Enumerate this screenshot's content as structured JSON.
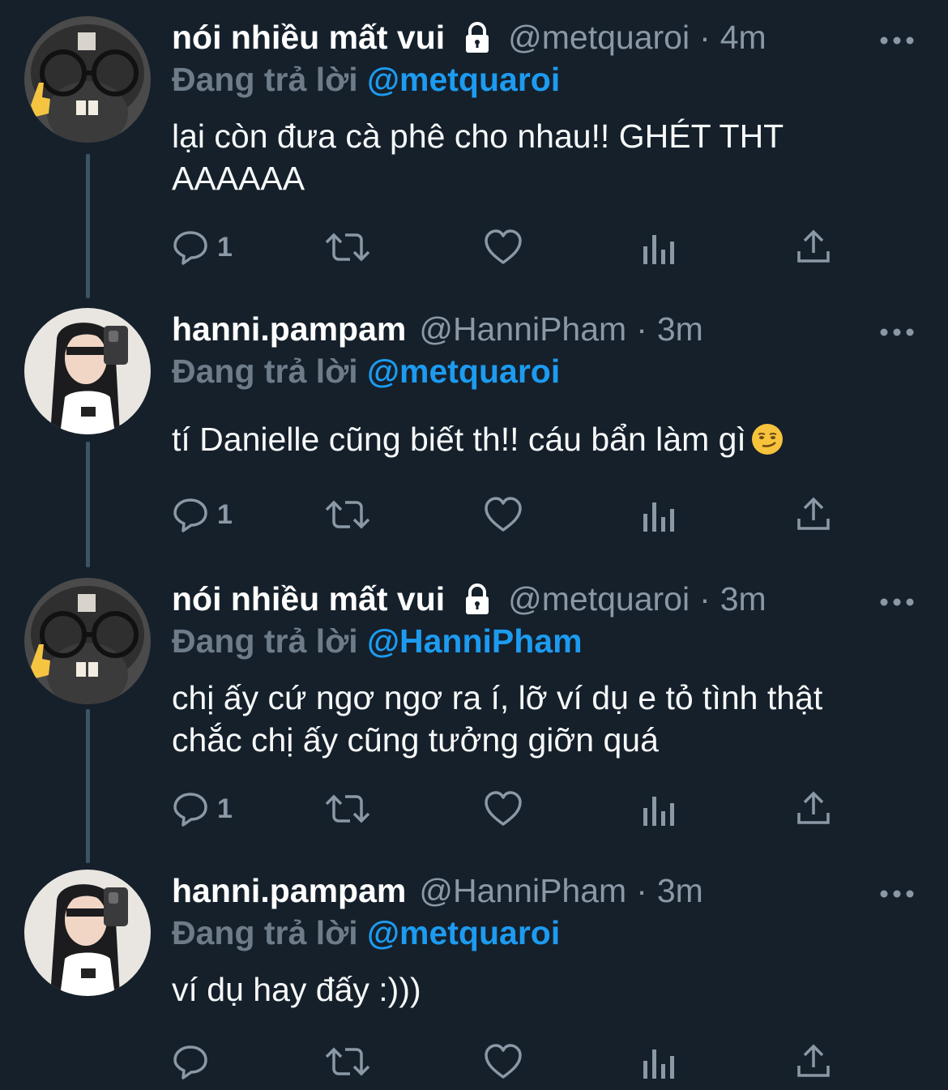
{
  "tweets": [
    {
      "name": "nói nhiều mất vui",
      "locked": true,
      "handle": "@metquaroi",
      "separator": "·",
      "time": "4m",
      "reply_label": "Đang trả lời",
      "reply_to": "@metquaroi",
      "text": "lại còn đưa cà phê cho nhau!! GHÉT THT AAAAAA",
      "reply_count": "1",
      "avatar": "cat-with-glasses"
    },
    {
      "name": "hanni.pampam",
      "locked": false,
      "handle": "@HanniPham",
      "separator": "·",
      "time": "3m",
      "reply_label": "Đang trả lời",
      "reply_to": "@metquaroi",
      "text": "tí Danielle cũng biết th!! cáu bẩn làm gì",
      "emoji": "smirking-face",
      "reply_count": "1",
      "avatar": "girl-mirror-selfie"
    },
    {
      "name": "nói nhiều mất vui",
      "locked": true,
      "handle": "@metquaroi",
      "separator": "·",
      "time": "3m",
      "reply_label": "Đang trả lời",
      "reply_to": "@HanniPham",
      "text": "chị ấy cứ ngơ ngơ ra í, lỡ ví dụ e tỏ tình thật chắc chị ấy cũng tưởng giỡn quá",
      "reply_count": "1",
      "avatar": "cat-with-glasses"
    },
    {
      "name": "hanni.pampam",
      "locked": false,
      "handle": "@HanniPham",
      "separator": "·",
      "time": "3m",
      "reply_label": "Đang trả lời",
      "reply_to": "@metquaroi",
      "text": "ví dụ hay đấy :)))",
      "reply_count": "",
      "avatar": "girl-mirror-selfie"
    }
  ],
  "icons": {
    "reply": "speech-bubble-icon",
    "retweet": "retweet-icon",
    "like": "heart-icon",
    "views": "bar-chart-icon",
    "share": "share-icon",
    "more": "more-dots-icon",
    "lock": "lock-icon"
  },
  "colors": {
    "background": "#15202b",
    "text": "#f7f9f9",
    "muted": "#8b98a5",
    "reply_label": "#6e7b88",
    "link": "#1d9bf0",
    "thread_line": "#3d5466"
  }
}
